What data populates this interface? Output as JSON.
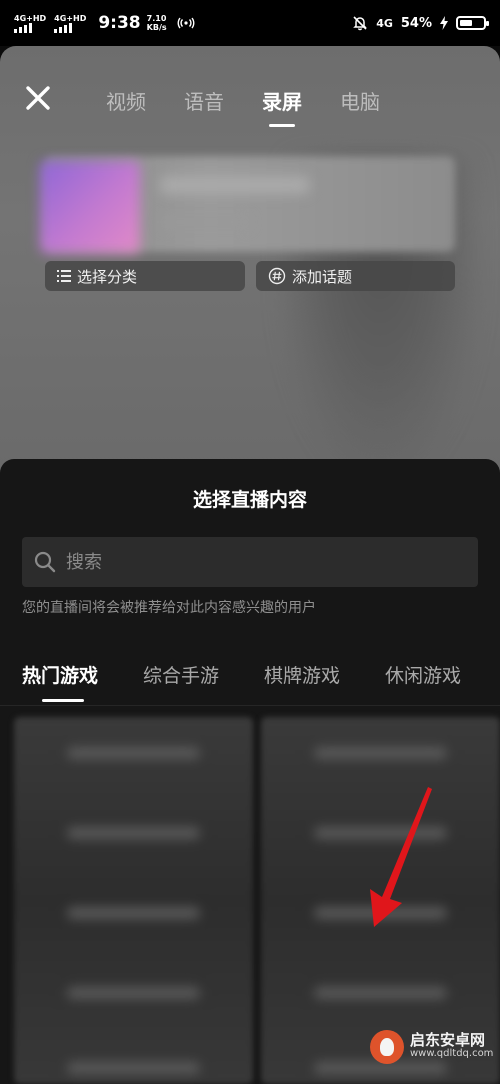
{
  "status_bar": {
    "sim1_label": "4G+HD",
    "sim2_label": "4G+HD",
    "time": "9:38",
    "speed_value": "7.10",
    "speed_unit": "KB/s",
    "network_label": "4G",
    "battery_percent": "54%",
    "battery_level": 0.54
  },
  "header": {
    "close_icon": "close-icon",
    "tabs": [
      {
        "label": "视频",
        "active": false
      },
      {
        "label": "语音",
        "active": false
      },
      {
        "label": "录屏",
        "active": true
      },
      {
        "label": "电脑",
        "active": false
      }
    ]
  },
  "chips": {
    "category": {
      "label": "选择分类",
      "icon": "list-icon"
    },
    "topic": {
      "label": "添加话题",
      "icon": "hash-icon"
    }
  },
  "sheet": {
    "title": "选择直播内容",
    "search": {
      "placeholder": "搜索",
      "value": "",
      "icon": "search-icon"
    },
    "hint": "您的直播间将会被推荐给对此内容感兴趣的用户",
    "tabs": [
      {
        "label": "热门游戏",
        "active": true
      },
      {
        "label": "综合手游",
        "active": false
      },
      {
        "label": "棋牌游戏",
        "active": false
      },
      {
        "label": "休闲游戏",
        "active": false
      }
    ]
  },
  "watermark": {
    "main": "启东安卓网",
    "sub": "www.qdltdq.com"
  },
  "colors": {
    "sheet_bg": "#161616",
    "search_bg": "#2c2c2c",
    "arrow": "#e0161b"
  }
}
